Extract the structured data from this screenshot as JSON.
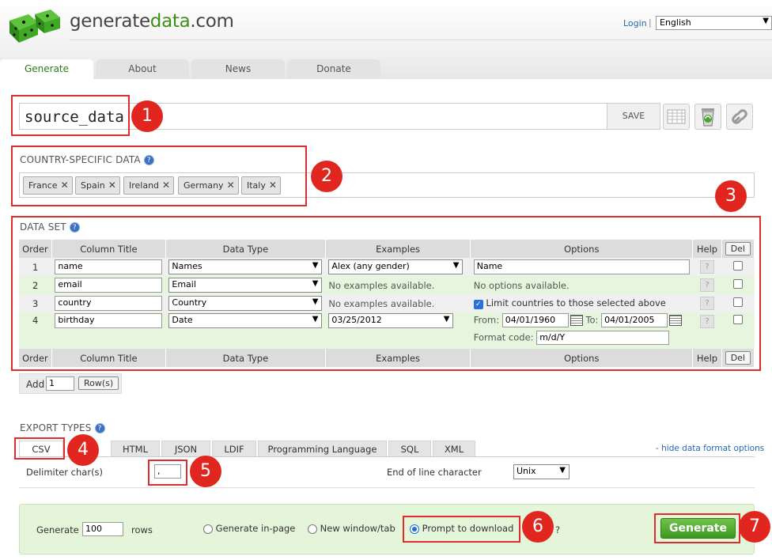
{
  "header": {
    "logo_text_a": "generate",
    "logo_text_b": "data",
    "logo_text_c": ".com",
    "login": "Login",
    "separator": "|",
    "language": "English"
  },
  "nav_tabs": [
    "Generate",
    "About",
    "News",
    "Donate"
  ],
  "dataset_name": "source_data",
  "save_label": "SAVE",
  "country_section": {
    "label": "COUNTRY-SPECIFIC DATA",
    "countries": [
      "France",
      "Spain",
      "Ireland",
      "Germany",
      "Italy"
    ]
  },
  "data_set": {
    "label": "DATA SET",
    "headers": [
      "Order",
      "Column Title",
      "Data Type",
      "Examples",
      "Options",
      "Help",
      "Del"
    ],
    "rows": [
      {
        "order": "1",
        "title": "name",
        "type": "Names",
        "example": "Alex (any gender)",
        "options": "Name"
      },
      {
        "order": "2",
        "title": "email",
        "type": "Email",
        "example": "No examples available.",
        "options": "No options available."
      },
      {
        "order": "3",
        "title": "country",
        "type": "Country",
        "example": "No examples available.",
        "options": "Limit countries to those selected above"
      },
      {
        "order": "4",
        "title": "birthday",
        "type": "Date",
        "example": "03/25/2012",
        "options": {
          "from_label": "From:",
          "from": "04/01/1960",
          "to_label": "To:",
          "to": "04/01/2005",
          "format_label": "Format code:",
          "format": "m/d/Y"
        }
      }
    ],
    "help_q": "?",
    "add_label": "Add",
    "add_count": "1",
    "rows_btn": "Row(s)"
  },
  "export": {
    "label": "EXPORT TYPES",
    "tabs": [
      "CSV",
      "HTML",
      "JSON",
      "LDIF",
      "Programming Language",
      "SQL",
      "XML"
    ],
    "hide_link": "- hide data format options",
    "delimiter_label": "Delimiter char(s)",
    "delimiter_value": ",",
    "eol_label": "End of line character",
    "eol_value": "Unix"
  },
  "generate": {
    "label": "Generate",
    "rows": "100",
    "rows_label": "rows",
    "opt_inpage": "Generate in-page",
    "opt_newwin": "New window/tab",
    "opt_prompt": "Prompt to download",
    "trailing": "?",
    "button": "Generate"
  },
  "badges": [
    "1",
    "2",
    "3",
    "4",
    "5",
    "6",
    "7"
  ],
  "colors": {
    "accent_green": "#3d8f1a",
    "highlight_red": "#e02c2c",
    "link_blue": "#2566b8"
  }
}
